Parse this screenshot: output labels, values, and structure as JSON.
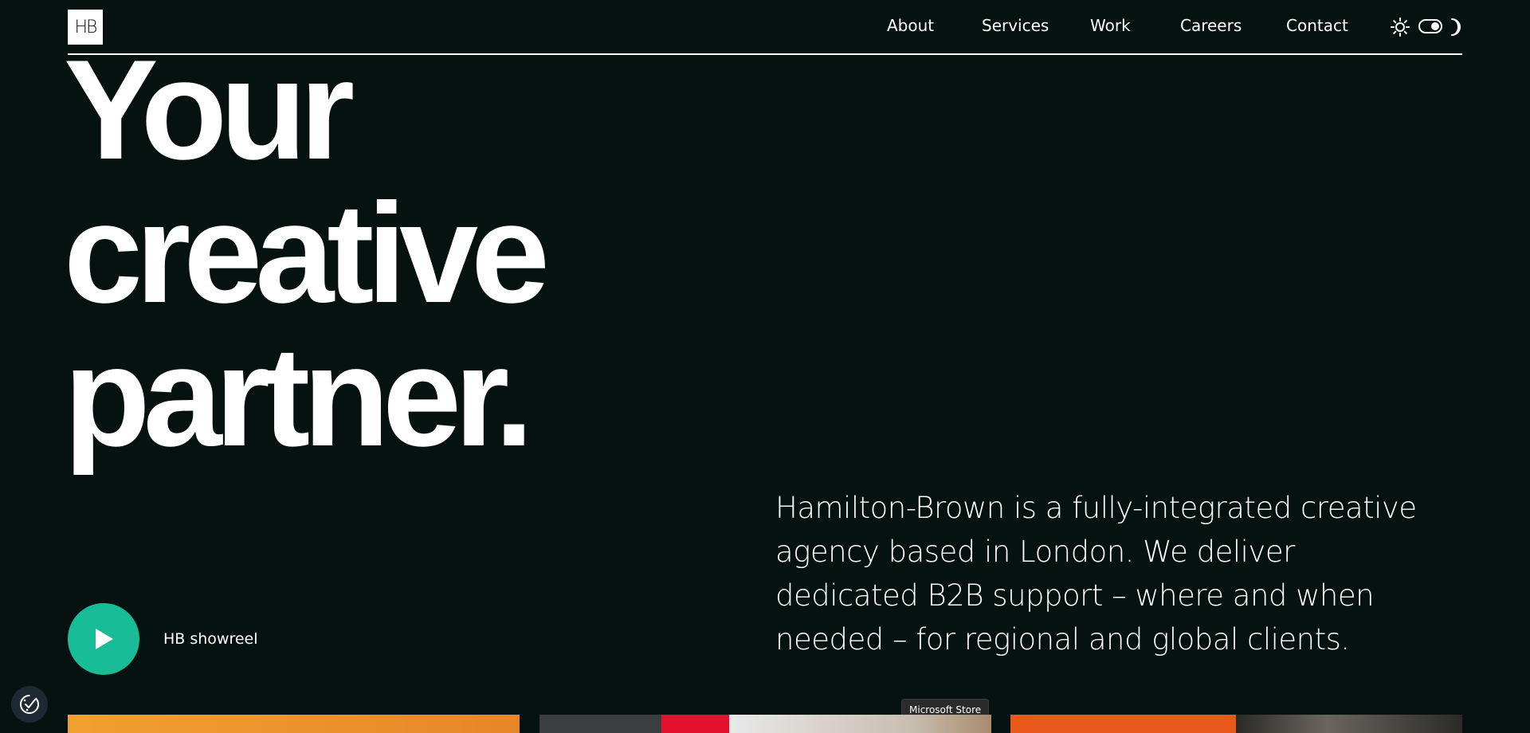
{
  "brand": {
    "logo_text": "HB"
  },
  "nav": {
    "items": [
      {
        "label": "About"
      },
      {
        "label": "Services"
      },
      {
        "label": "Work"
      },
      {
        "label": "Careers"
      },
      {
        "label": "Contact"
      }
    ],
    "theme_toggle": {
      "icons": [
        "sun-icon",
        "moon-icon"
      ],
      "state": "dark"
    }
  },
  "hero": {
    "headline_lines": [
      "Your",
      "creative",
      "partner."
    ],
    "intro": "Hamilton-Brown is a fully-integrated creative agency based in London. We deliver dedicated B2B support – where and when needed – for regional and global clients.",
    "showreel_label": "HB showreel"
  },
  "tooltip": {
    "text": "Microsoft Store"
  },
  "colors": {
    "background": "#061210",
    "text": "#ffffff",
    "accent": "#18bd98"
  }
}
